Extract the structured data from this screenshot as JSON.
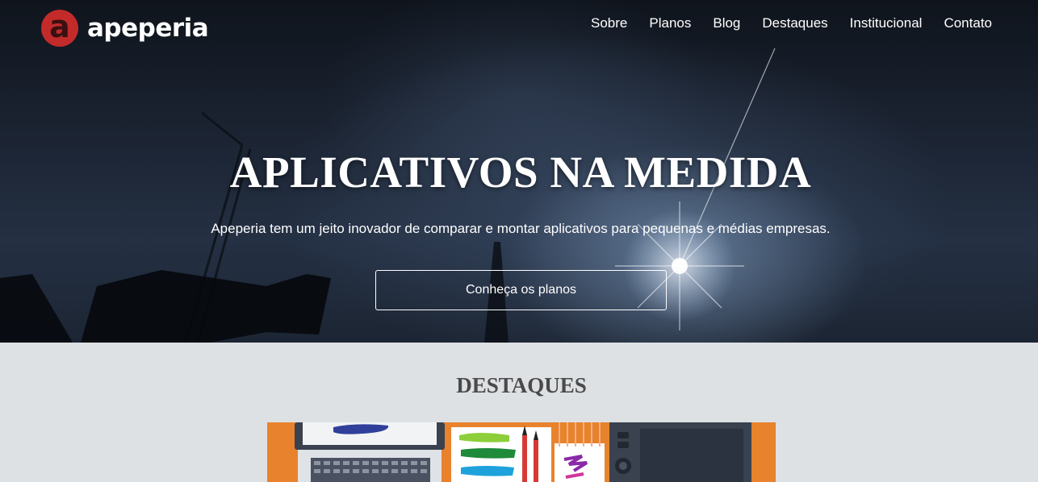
{
  "brand": {
    "logo_letter": "a",
    "name": "apeperia",
    "accent_color": "#c32b2b"
  },
  "nav": {
    "items": [
      {
        "label": "Sobre"
      },
      {
        "label": "Planos"
      },
      {
        "label": "Blog"
      },
      {
        "label": "Destaques"
      },
      {
        "label": "Institucional"
      },
      {
        "label": "Contato"
      }
    ]
  },
  "hero": {
    "title": "APLICATIVOS NA MEDIDA",
    "subtitle": "Apeperia tem um jeito inovador de comparar e montar aplicativos para pequenas e médias empresas.",
    "cta_label": "Conheça os planos"
  },
  "highlights": {
    "title": "DESTAQUES",
    "card_background": "#e8822c"
  }
}
